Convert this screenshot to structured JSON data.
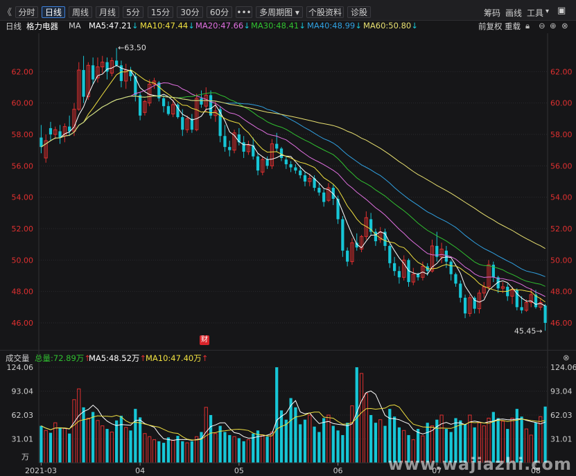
{
  "toolbar": {
    "back": "《",
    "periods": [
      "分时",
      "日线",
      "周线",
      "月线",
      "5分",
      "15分",
      "30分",
      "60分",
      "•••"
    ],
    "active_period": "日线",
    "multi_period": "多周期图",
    "stock_info": "个股资料",
    "diagnose": "诊股",
    "right": [
      "筹码",
      "画线",
      "工具"
    ]
  },
  "info": {
    "period": "日线",
    "stock_name": "格力电器",
    "ma_label": "MA",
    "ma5": "MA5:47.21",
    "ma10": "MA10:47.44",
    "ma20": "MA20:47.66",
    "ma30": "MA30:48.41",
    "ma40": "MA40:48.99",
    "ma60": "MA60:50.80",
    "fq": "前复权",
    "reset": "重载"
  },
  "colors": {
    "up": "#e03030",
    "down": "#16c6d6",
    "ma5": "#ffffff",
    "ma10": "#f0e040",
    "ma20": "#e070e0",
    "ma30": "#30c030",
    "ma40": "#30a0e0",
    "ma60": "#e8e070"
  },
  "chart_data": {
    "type": "candlestick",
    "price_ticks": [
      "62.00",
      "60.00",
      "58.00",
      "56.00",
      "54.00",
      "52.00",
      "50.00",
      "48.00",
      "46.00"
    ],
    "high_label": "63.50",
    "low_label": "45.45",
    "event_badge": "财",
    "volume_ticks": [
      "124.06",
      "93.04",
      "62.03",
      "31.01"
    ],
    "volume_unit": "万",
    "x_ticks": [
      "2021-03",
      "04",
      "05",
      "06",
      "07",
      "08"
    ],
    "candles": [
      [
        57.8,
        58.6,
        56.8,
        57.2
      ],
      [
        56.5,
        58.0,
        56.2,
        57.6
      ],
      [
        58.4,
        58.8,
        57.6,
        58.0
      ],
      [
        58.0,
        58.5,
        57.7,
        58.3
      ],
      [
        58.2,
        58.6,
        57.4,
        57.8
      ],
      [
        57.9,
        58.7,
        57.5,
        58.5
      ],
      [
        58.5,
        59.2,
        57.9,
        58.2
      ],
      [
        58.2,
        60.0,
        57.9,
        59.6
      ],
      [
        59.6,
        62.6,
        59.5,
        62.1
      ],
      [
        62.1,
        63.0,
        60.0,
        60.4
      ],
      [
        60.4,
        62.6,
        60.2,
        62.4
      ],
      [
        62.4,
        62.9,
        61.2,
        61.5
      ],
      [
        61.6,
        62.9,
        61.3,
        62.3
      ],
      [
        62.3,
        63.0,
        61.9,
        62.6
      ],
      [
        62.6,
        62.9,
        61.5,
        62.0
      ],
      [
        61.9,
        62.9,
        61.7,
        62.7
      ],
      [
        62.7,
        63.5,
        62.3,
        62.4
      ],
      [
        62.4,
        62.7,
        61.0,
        61.4
      ],
      [
        61.4,
        62.5,
        60.9,
        62.1
      ],
      [
        62.1,
        62.3,
        61.4,
        61.7
      ],
      [
        61.7,
        61.9,
        60.1,
        60.5
      ],
      [
        60.5,
        60.7,
        58.9,
        59.2
      ],
      [
        59.4,
        60.2,
        59.2,
        60.1
      ],
      [
        60.0,
        61.5,
        59.8,
        61.2
      ],
      [
        61.2,
        61.6,
        60.9,
        61.4
      ],
      [
        61.3,
        61.4,
        60.1,
        60.3
      ],
      [
        60.3,
        60.5,
        59.4,
        59.8
      ],
      [
        59.8,
        60.1,
        59.2,
        59.3
      ],
      [
        59.3,
        60.2,
        59.1,
        59.9
      ],
      [
        59.9,
        60.0,
        59.0,
        59.1
      ],
      [
        59.1,
        59.6,
        57.9,
        58.3
      ],
      [
        58.3,
        59.2,
        58.1,
        59.0
      ],
      [
        59.0,
        59.3,
        58.1,
        58.3
      ],
      [
        58.3,
        60.6,
        58.2,
        60.3
      ],
      [
        60.3,
        60.8,
        59.7,
        59.9
      ],
      [
        59.8,
        61.0,
        59.4,
        60.5
      ],
      [
        60.5,
        60.8,
        59.0,
        59.2
      ],
      [
        59.2,
        60.1,
        58.8,
        59.5
      ],
      [
        59.6,
        59.8,
        57.5,
        57.9
      ],
      [
        57.9,
        58.6,
        56.9,
        57.2
      ],
      [
        57.2,
        57.6,
        56.6,
        57.0
      ],
      [
        57.0,
        58.3,
        56.8,
        58.1
      ],
      [
        58.0,
        58.4,
        57.3,
        57.5
      ],
      [
        57.5,
        57.9,
        56.5,
        56.9
      ],
      [
        56.9,
        57.6,
        56.7,
        57.3
      ],
      [
        57.3,
        57.8,
        56.4,
        56.6
      ],
      [
        56.6,
        56.8,
        55.4,
        55.7
      ],
      [
        55.6,
        56.6,
        55.4,
        56.4
      ],
      [
        56.4,
        56.6,
        55.8,
        56.0
      ],
      [
        56.0,
        57.7,
        55.8,
        57.4
      ],
      [
        57.4,
        58.1,
        56.9,
        57.1
      ],
      [
        57.1,
        57.2,
        56.3,
        56.5
      ],
      [
        56.4,
        56.6,
        55.8,
        56.1
      ],
      [
        56.1,
        56.3,
        55.6,
        55.9
      ],
      [
        55.9,
        56.1,
        55.5,
        55.7
      ],
      [
        55.7,
        56.0,
        55.2,
        55.4
      ],
      [
        55.4,
        55.6,
        54.7,
        55.0
      ],
      [
        55.0,
        55.5,
        54.7,
        55.2
      ],
      [
        55.2,
        55.4,
        54.4,
        54.6
      ],
      [
        54.6,
        54.9,
        54.1,
        54.3
      ],
      [
        54.3,
        54.5,
        53.4,
        53.7
      ],
      [
        53.8,
        54.9,
        53.7,
        54.6
      ],
      [
        54.6,
        54.8,
        53.5,
        53.9
      ],
      [
        53.9,
        54.1,
        52.3,
        52.6
      ],
      [
        52.6,
        52.8,
        50.2,
        50.6
      ],
      [
        50.6,
        50.8,
        49.6,
        49.9
      ],
      [
        49.9,
        51.4,
        49.7,
        51.1
      ],
      [
        51.1,
        51.7,
        50.6,
        50.8
      ],
      [
        50.7,
        51.6,
        50.5,
        51.5
      ],
      [
        51.5,
        53.1,
        51.3,
        52.7
      ],
      [
        52.6,
        53.0,
        51.6,
        51.8
      ],
      [
        51.8,
        52.0,
        50.9,
        51.2
      ],
      [
        51.3,
        52.1,
        51.1,
        51.8
      ],
      [
        51.8,
        52.0,
        50.6,
        50.9
      ],
      [
        50.9,
        51.0,
        49.5,
        49.8
      ],
      [
        49.8,
        50.2,
        49.0,
        49.3
      ],
      [
        49.3,
        49.6,
        48.5,
        48.9
      ],
      [
        48.9,
        50.3,
        48.7,
        50.0
      ],
      [
        50.0,
        50.1,
        48.3,
        48.6
      ],
      [
        48.6,
        49.5,
        48.4,
        49.1
      ],
      [
        49.1,
        49.2,
        48.7,
        48.9
      ],
      [
        48.9,
        49.9,
        48.7,
        49.6
      ],
      [
        49.6,
        49.8,
        49.0,
        49.3
      ],
      [
        49.3,
        51.3,
        49.2,
        50.9
      ],
      [
        50.9,
        51.8,
        49.9,
        50.2
      ],
      [
        50.2,
        51.1,
        49.8,
        50.7
      ],
      [
        50.6,
        50.9,
        49.5,
        49.9
      ],
      [
        49.9,
        50.0,
        48.7,
        49.1
      ],
      [
        49.1,
        49.2,
        48.3,
        48.5
      ],
      [
        48.5,
        48.7,
        47.3,
        47.6
      ],
      [
        47.6,
        47.8,
        46.3,
        46.6
      ],
      [
        46.6,
        47.8,
        46.4,
        47.6
      ],
      [
        47.6,
        47.7,
        46.6,
        46.9
      ],
      [
        46.9,
        48.1,
        46.6,
        47.9
      ],
      [
        47.9,
        48.6,
        47.6,
        48.3
      ],
      [
        48.3,
        50.0,
        48.1,
        49.7
      ],
      [
        49.7,
        49.9,
        48.6,
        48.9
      ],
      [
        48.9,
        49.0,
        47.9,
        48.2
      ],
      [
        48.2,
        48.6,
        47.9,
        48.3
      ],
      [
        48.3,
        48.5,
        47.4,
        47.7
      ],
      [
        47.7,
        48.3,
        47.2,
        48.1
      ],
      [
        48.1,
        48.2,
        46.8,
        47.0
      ],
      [
        47.0,
        47.7,
        46.6,
        46.8
      ],
      [
        46.8,
        47.5,
        46.7,
        47.3
      ],
      [
        47.3,
        48.2,
        47.0,
        47.8
      ],
      [
        47.8,
        48.1,
        46.9,
        47.0
      ],
      [
        47.0,
        47.6,
        46.8,
        47.3
      ],
      [
        47.1,
        47.2,
        45.5,
        46.0
      ]
    ],
    "volumes": [
      48,
      42,
      39,
      52,
      46,
      45,
      38,
      82,
      96,
      72,
      58,
      66,
      55,
      48,
      44,
      40,
      55,
      61,
      46,
      42,
      70,
      59,
      38,
      34,
      30,
      28,
      26,
      33,
      29,
      35,
      28,
      26,
      28,
      34,
      40,
      72,
      62,
      38,
      48,
      40,
      36,
      34,
      32,
      28,
      30,
      38,
      42,
      36,
      34,
      40,
      124,
      68,
      56,
      84,
      72,
      50,
      56,
      62,
      47,
      40,
      58,
      62,
      48,
      42,
      36,
      52,
      74,
      124,
      116,
      90,
      62,
      52,
      56,
      48,
      70,
      60,
      46,
      42,
      36,
      30,
      44,
      35,
      52,
      48,
      56,
      62,
      44,
      40,
      58,
      55,
      50,
      62,
      46,
      52,
      48,
      58,
      66,
      58,
      54,
      44,
      58,
      70,
      60,
      44,
      36,
      52,
      60,
      73
    ]
  }
}
